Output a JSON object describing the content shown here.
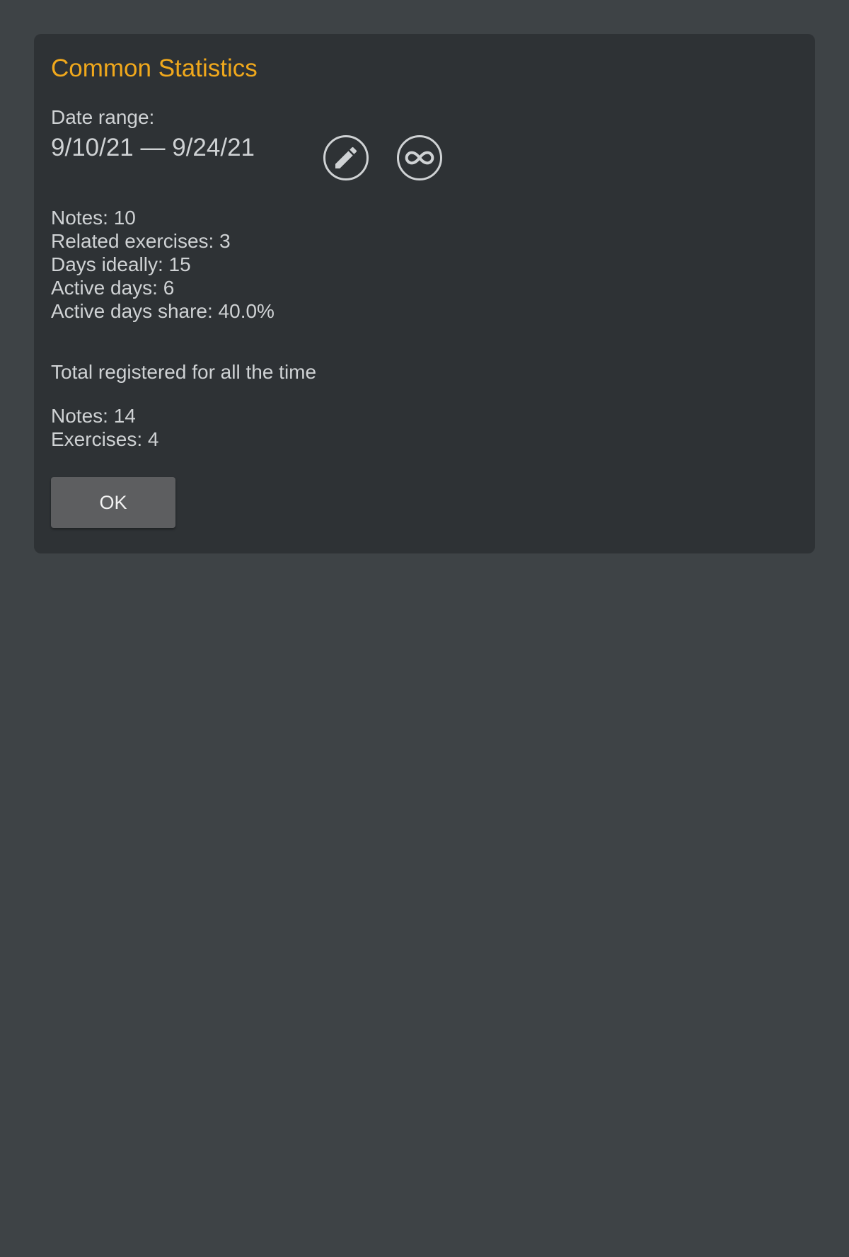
{
  "dialog": {
    "title": "Common Statistics",
    "title_color": "#f0a81c",
    "date_range_label": "Date range:",
    "date_range_value": "9/10/21 — 9/24/21",
    "icons": {
      "edit": "pencil-icon",
      "all_time": "infinity-icon"
    },
    "period_stats": {
      "notes": "Notes: 10",
      "related_exercises": "Related exercises: 3",
      "days_ideally": "Days ideally: 15",
      "active_days": "Active days: 6",
      "active_days_share": "Active days share: 40.0%"
    },
    "total_heading": "Total registered for all the time",
    "totals": {
      "notes": "Notes: 14",
      "exercises": "Exercises: 4"
    },
    "ok_label": "OK"
  }
}
